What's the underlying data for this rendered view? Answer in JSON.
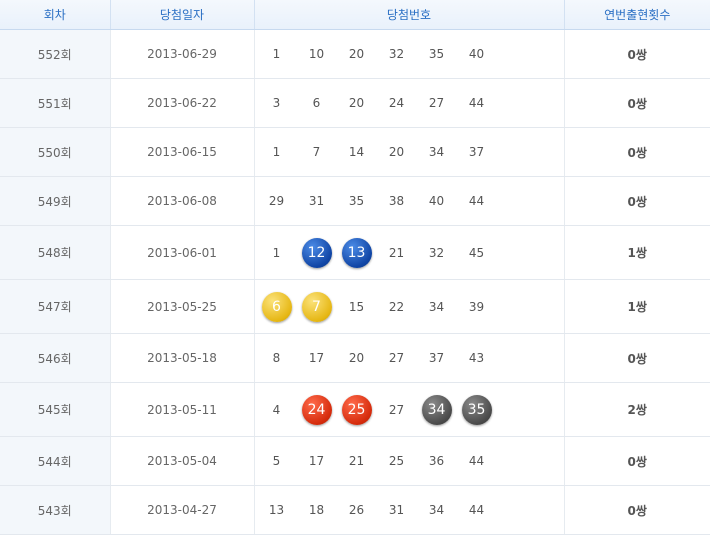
{
  "columns": {
    "round": "회차",
    "date": "당첨일자",
    "numbers": "당첨번호",
    "pairs": "연번출현횟수"
  },
  "rows": [
    {
      "round": "552회",
      "date": "2013-06-29",
      "pairs": "0쌍",
      "numbers": [
        {
          "value": "1"
        },
        {
          "value": "10"
        },
        {
          "value": "20"
        },
        {
          "value": "32"
        },
        {
          "value": "35"
        },
        {
          "value": "40"
        }
      ]
    },
    {
      "round": "551회",
      "date": "2013-06-22",
      "pairs": "0쌍",
      "numbers": [
        {
          "value": "3"
        },
        {
          "value": "6"
        },
        {
          "value": "20"
        },
        {
          "value": "24"
        },
        {
          "value": "27"
        },
        {
          "value": "44"
        }
      ]
    },
    {
      "round": "550회",
      "date": "2013-06-15",
      "pairs": "0쌍",
      "numbers": [
        {
          "value": "1"
        },
        {
          "value": "7"
        },
        {
          "value": "14"
        },
        {
          "value": "20"
        },
        {
          "value": "34"
        },
        {
          "value": "37"
        }
      ]
    },
    {
      "round": "549회",
      "date": "2013-06-08",
      "pairs": "0쌍",
      "numbers": [
        {
          "value": "29"
        },
        {
          "value": "31"
        },
        {
          "value": "35"
        },
        {
          "value": "38"
        },
        {
          "value": "40"
        },
        {
          "value": "44"
        }
      ]
    },
    {
      "round": "548회",
      "date": "2013-06-01",
      "pairs": "1쌍",
      "numbers": [
        {
          "value": "1"
        },
        {
          "value": "12",
          "ball": "blue"
        },
        {
          "value": "13",
          "ball": "blue"
        },
        {
          "value": "21"
        },
        {
          "value": "32"
        },
        {
          "value": "45"
        }
      ]
    },
    {
      "round": "547회",
      "date": "2013-05-25",
      "pairs": "1쌍",
      "numbers": [
        {
          "value": "6",
          "ball": "yellow"
        },
        {
          "value": "7",
          "ball": "yellow"
        },
        {
          "value": "15"
        },
        {
          "value": "22"
        },
        {
          "value": "34"
        },
        {
          "value": "39"
        }
      ]
    },
    {
      "round": "546회",
      "date": "2013-05-18",
      "pairs": "0쌍",
      "numbers": [
        {
          "value": "8"
        },
        {
          "value": "17"
        },
        {
          "value": "20"
        },
        {
          "value": "27"
        },
        {
          "value": "37"
        },
        {
          "value": "43"
        }
      ]
    },
    {
      "round": "545회",
      "date": "2013-05-11",
      "pairs": "2쌍",
      "numbers": [
        {
          "value": "4"
        },
        {
          "value": "24",
          "ball": "red"
        },
        {
          "value": "25",
          "ball": "red"
        },
        {
          "value": "27"
        },
        {
          "value": "34",
          "ball": "gray"
        },
        {
          "value": "35",
          "ball": "gray"
        }
      ]
    },
    {
      "round": "544회",
      "date": "2013-05-04",
      "pairs": "0쌍",
      "numbers": [
        {
          "value": "5"
        },
        {
          "value": "17"
        },
        {
          "value": "21"
        },
        {
          "value": "25"
        },
        {
          "value": "36"
        },
        {
          "value": "44"
        }
      ]
    },
    {
      "round": "543회",
      "date": "2013-04-27",
      "pairs": "0쌍",
      "numbers": [
        {
          "value": "13"
        },
        {
          "value": "18"
        },
        {
          "value": "26"
        },
        {
          "value": "31"
        },
        {
          "value": "34"
        },
        {
          "value": "44"
        }
      ]
    }
  ]
}
